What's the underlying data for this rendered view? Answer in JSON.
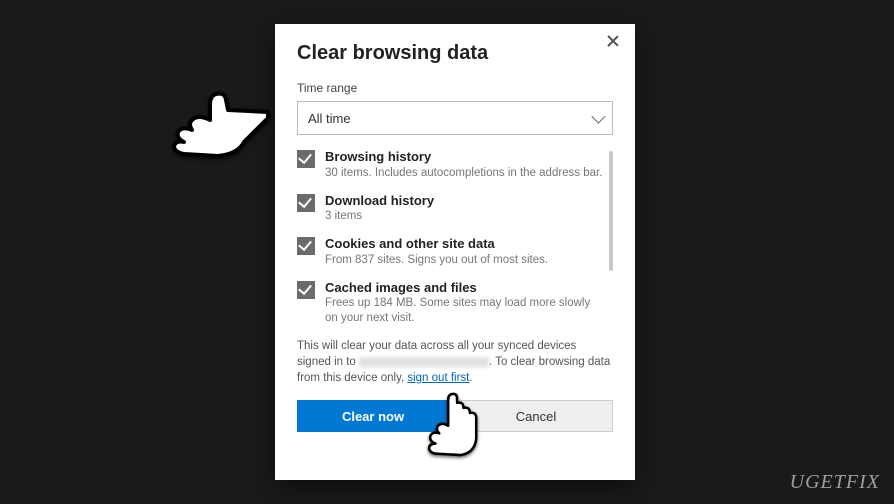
{
  "dialog": {
    "title": "Clear browsing data",
    "time_range_label": "Time range",
    "time_range_value": "All time",
    "options": [
      {
        "checked": true,
        "title": "Browsing history",
        "subtitle": "30 items. Includes autocompletions in the address bar."
      },
      {
        "checked": true,
        "title": "Download history",
        "subtitle": "3 items"
      },
      {
        "checked": true,
        "title": "Cookies and other site data",
        "subtitle": "From 837 sites. Signs you out of most sites."
      },
      {
        "checked": true,
        "title": "Cached images and files",
        "subtitle": "Frees up 184 MB. Some sites may load more slowly on your next visit."
      }
    ],
    "note_part1": "This will clear your data across all your synced devices signed in to ",
    "note_part2": ". To clear browsing data from this device only, ",
    "note_link": "sign out first",
    "note_part3": ".",
    "primary_btn": "Clear now",
    "secondary_btn": "Cancel"
  },
  "watermark": "UGETFIX"
}
